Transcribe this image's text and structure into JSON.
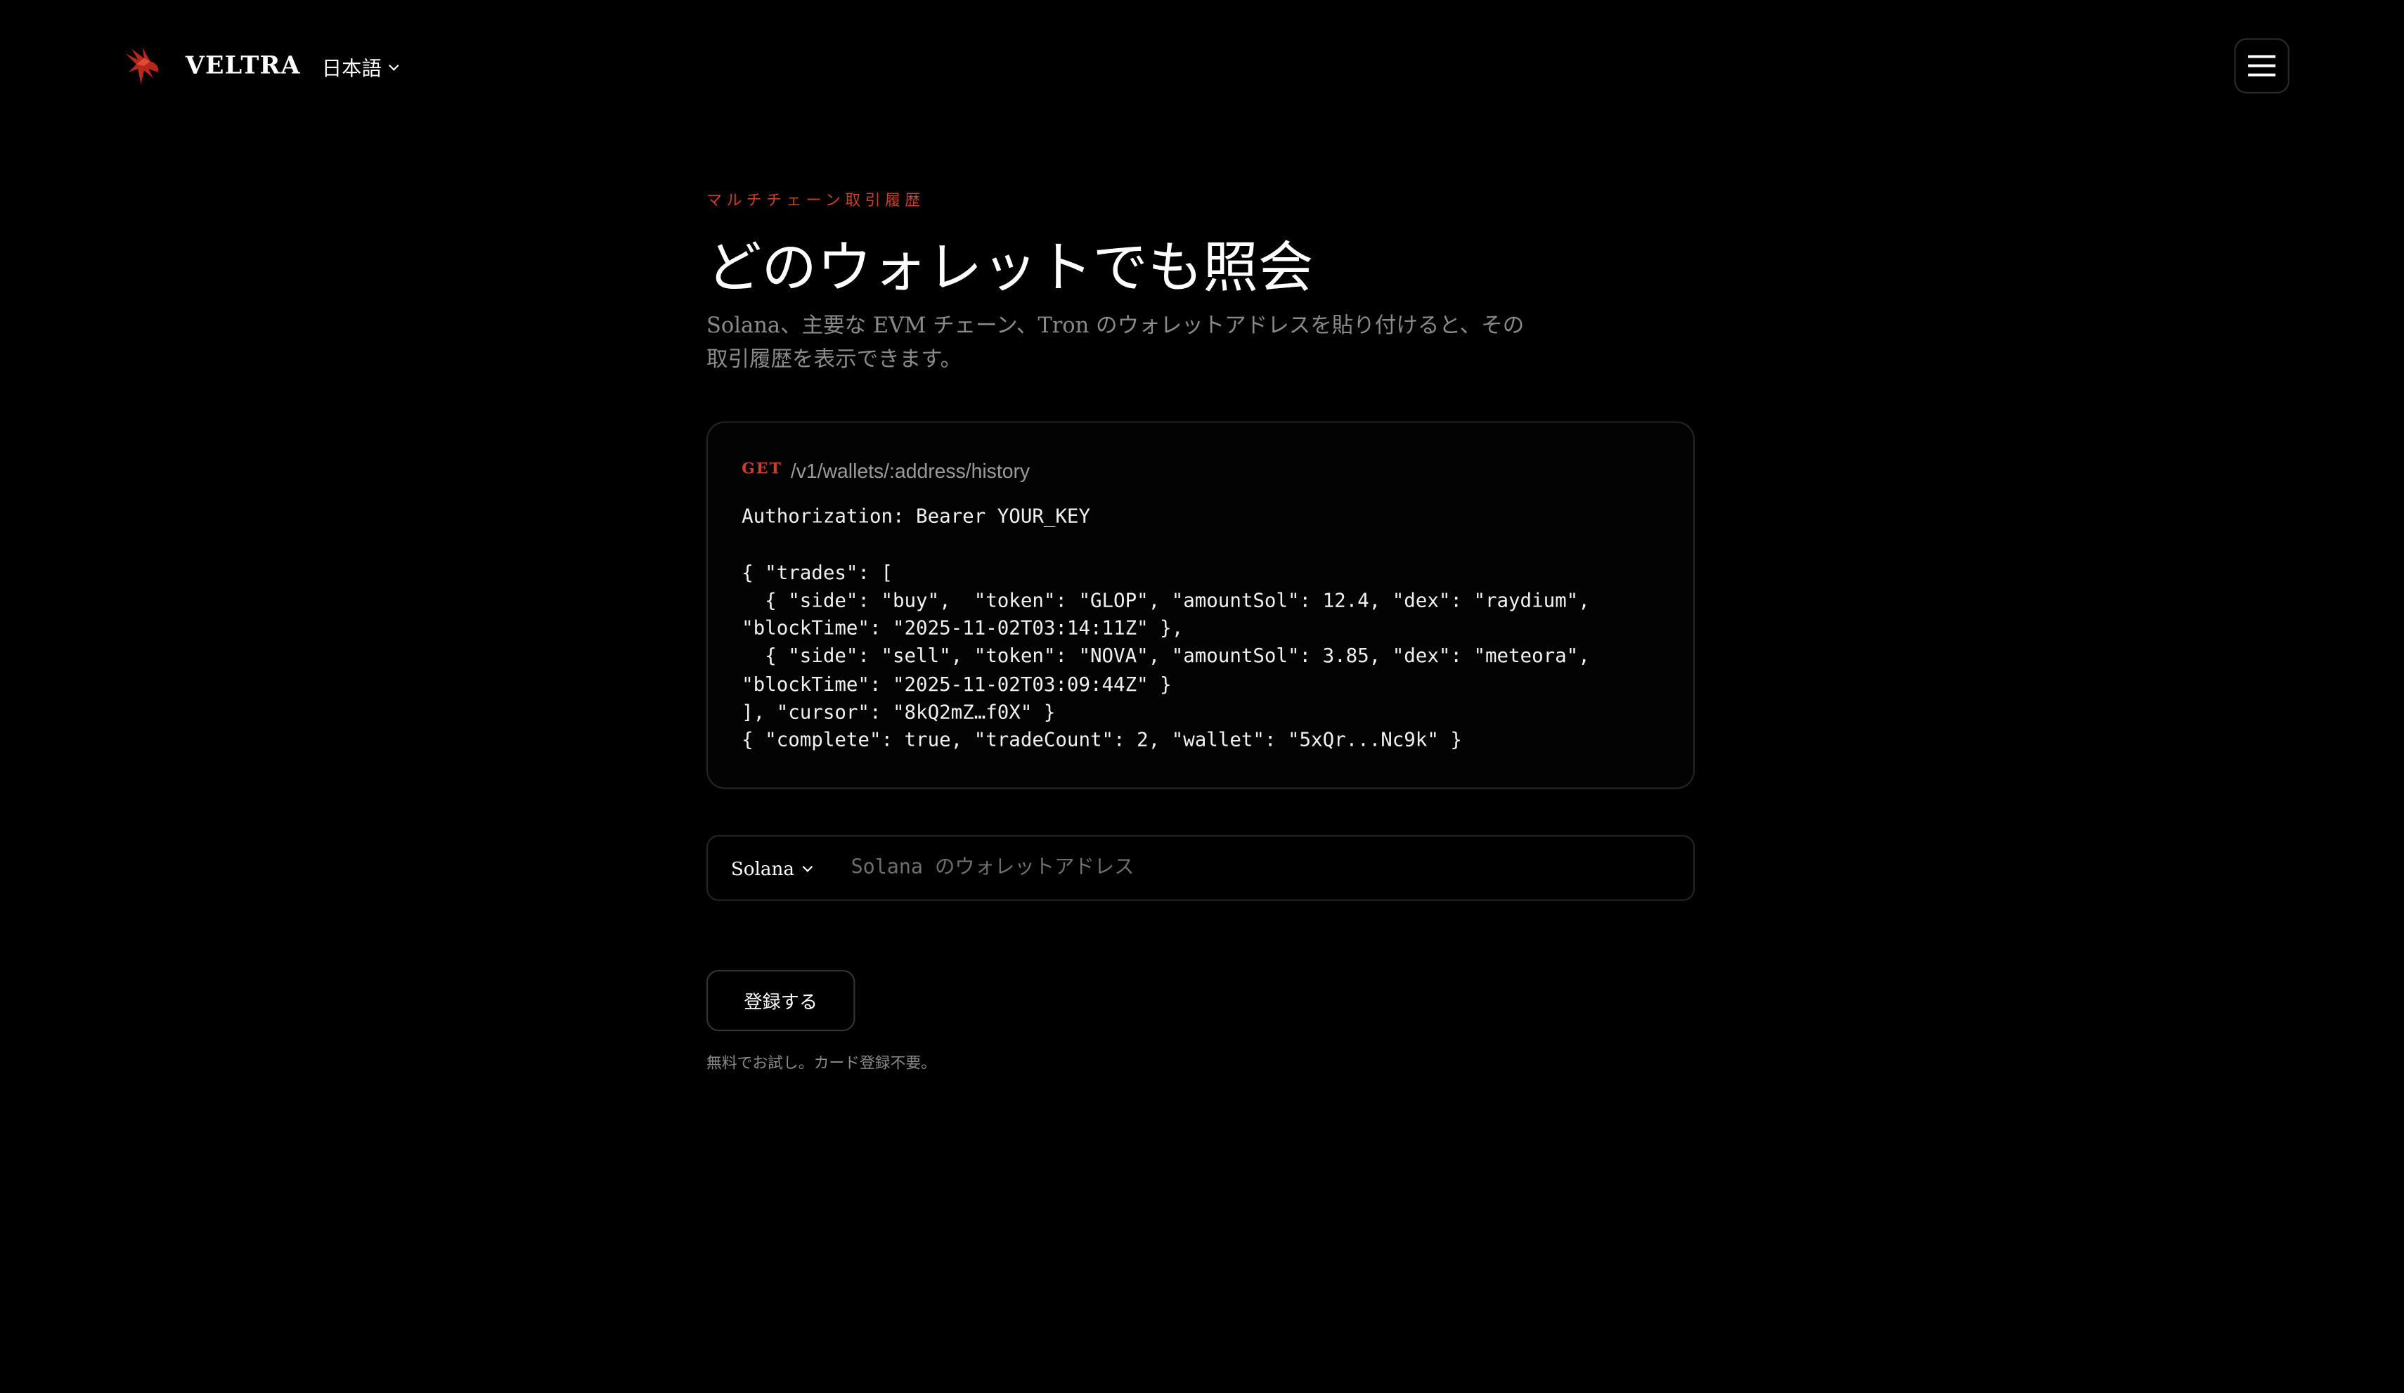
{
  "header": {
    "brand": "VELTRA",
    "language": "日本語"
  },
  "hero": {
    "eyebrow": "マルチチェーン取引履歴",
    "title": "どのウォレットでも照会",
    "description": "Solana、主要な EVM チェーン、Tron のウォレットアドレスを貼り付けると、その取引履歴を表示できます。"
  },
  "code_card": {
    "method": "GET",
    "endpoint": "/v1/wallets/:address/history",
    "code": "Authorization: Bearer YOUR_KEY\n\n{ \"trades\": [\n  { \"side\": \"buy\",  \"token\": \"GLOP\", \"amountSol\": 12.4, \"dex\": \"raydium\",\n\"blockTime\": \"2025-11-02T03:14:11Z\" },\n  { \"side\": \"sell\", \"token\": \"NOVA\", \"amountSol\": 3.85, \"dex\": \"meteora\",\n\"blockTime\": \"2025-11-02T03:09:44Z\" }\n], \"cursor\": \"8kQ2mZ…f0X\" }\n{ \"complete\": true, \"tradeCount\": 2, \"wallet\": \"5xQr...Nc9k\" }"
  },
  "lookup": {
    "chain": "Solana",
    "placeholder": "Solana のウォレットアドレス",
    "value": ""
  },
  "cta": {
    "button_label": "登録する",
    "note": "無料でお試し。カード登録不要。"
  },
  "colors": {
    "accent": "#c8412c",
    "background": "#000000"
  }
}
